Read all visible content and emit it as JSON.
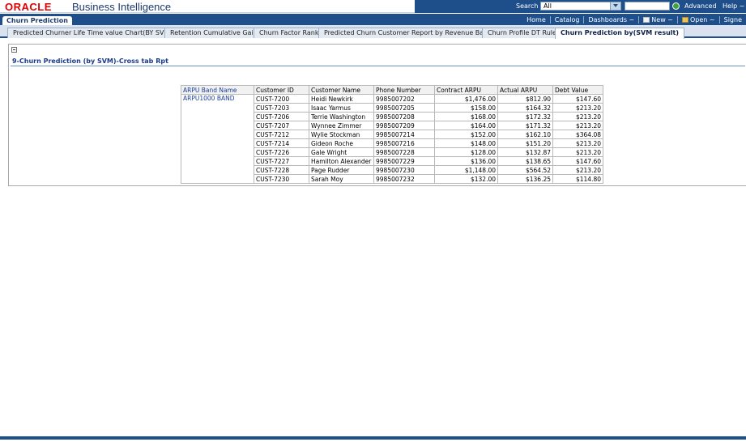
{
  "brand": {
    "oracle": "ORACLE",
    "product": "Business Intelligence"
  },
  "search": {
    "label": "Search",
    "scope": "All",
    "advanced": "Advanced",
    "help": "Help ~"
  },
  "navbar": {
    "dashboard": "Churn Prediction",
    "links": {
      "home": "Home",
      "catalog": "Catalog",
      "dashboards": "Dashboards ~",
      "new": "New ~",
      "open": "Open ~",
      "signed": "Signe"
    }
  },
  "tabs": [
    "Predicted Churner Life Time value Chart(BY SVM)",
    "Retention Cumulative Gain",
    "Churn Factor Rank",
    "Predicted Churn Customer Report by Revenue Band",
    "Churn Profile DT Rule",
    "Churn Prediction by(SVM result)"
  ],
  "report": {
    "title": "9-Churn Prediction (by SVM)-Cross tab Rpt",
    "headers": [
      "ARPU Band Name",
      "Customer ID",
      "Customer Name",
      "Phone Number",
      "Contract ARPU",
      "Actual ARPU",
      "Debt Value"
    ],
    "band": "ARPU1000 BAND",
    "rows": [
      [
        "CUST-7200",
        "Heidi Newkirk",
        "9985007202",
        "$1,476.00",
        "$812.90",
        "$147.60"
      ],
      [
        "CUST-7203",
        "Isaac Yarmus",
        "9985007205",
        "$158.00",
        "$164.32",
        "$213.20"
      ],
      [
        "CUST-7206",
        "Terrie Washington",
        "9985007208",
        "$168.00",
        "$172.32",
        "$213.20"
      ],
      [
        "CUST-7207",
        "Wynnee Zimmer",
        "9985007209",
        "$164.00",
        "$171.32",
        "$213.20"
      ],
      [
        "CUST-7212",
        "Wylie Stockman",
        "9985007214",
        "$152.00",
        "$162.10",
        "$364.08"
      ],
      [
        "CUST-7214",
        "Gideon Roche",
        "9985007216",
        "$148.00",
        "$151.20",
        "$213.20"
      ],
      [
        "CUST-7226",
        "Gale Wright",
        "9985007228",
        "$128.00",
        "$132.87",
        "$213.20"
      ],
      [
        "CUST-7227",
        "Hamilton Alexander",
        "9985007229",
        "$136.00",
        "$138.65",
        "$147.60"
      ],
      [
        "CUST-7228",
        "Page Rudder",
        "9985007230",
        "$1,148.00",
        "$564.52",
        "$213.20"
      ],
      [
        "CUST-7230",
        "Sarah Moy",
        "9985007232",
        "$132.00",
        "$136.25",
        "$114.80"
      ]
    ]
  }
}
